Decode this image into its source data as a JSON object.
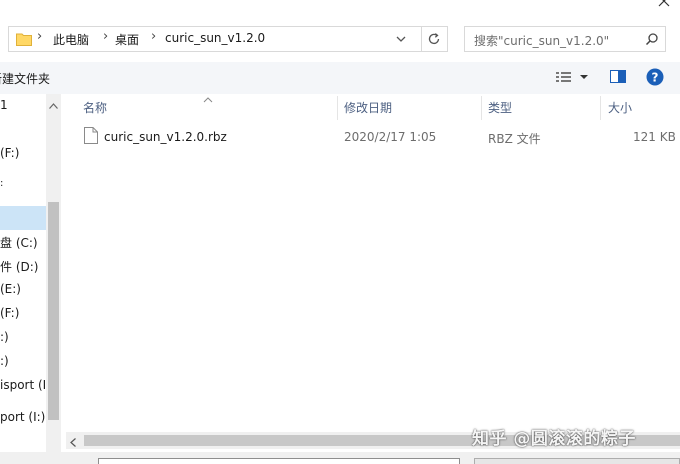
{
  "breadcrumb": {
    "items": [
      "此电脑",
      "桌面",
      "curic_sun_v1.2.0"
    ]
  },
  "search": {
    "placeholder": "搜索\"curic_sun_v1.2.0\""
  },
  "toolbar": {
    "new_folder": "新建文件夹"
  },
  "nav": {
    "items": [
      "1",
      "(F:)",
      "",
      "",
      "盘 (C:)",
      "件 (D:)",
      "(E:)",
      "(F:)",
      ":)",
      ":)",
      "isport (I:",
      "port (I:)"
    ]
  },
  "columns": {
    "name": "名称",
    "modified": "修改日期",
    "type": "类型",
    "size": "大小"
  },
  "files": [
    {
      "name": "curic_sun_v1.2.0.rbz",
      "modified": "2020/2/17 1:05",
      "type": "RBZ 文件",
      "size": "121 KB"
    }
  ],
  "watermark": "知乎 @圆滚滚的粽子",
  "colors": {
    "accent": "#0078d7",
    "selection": "#cce4f7",
    "help": "#1b5fb8"
  }
}
